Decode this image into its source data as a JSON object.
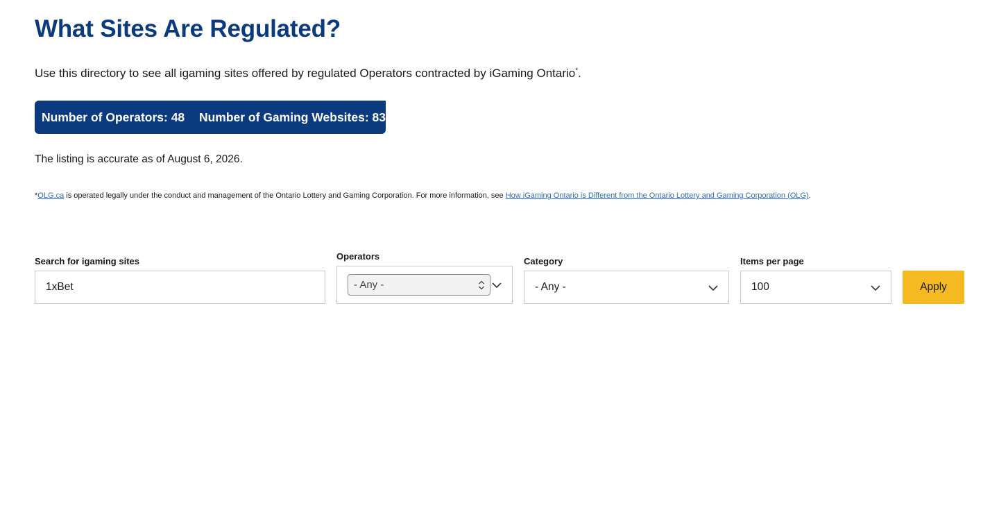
{
  "heading": "What Sites Are Regulated?",
  "intro": {
    "text": "Use this directory to see all igaming sites offered by regulated Operators contracted by iGaming Ontario",
    "marker": "*",
    "end": "."
  },
  "stats": {
    "operators_label": "Number of Operators: 48",
    "websites_label": "Number of Gaming Websites: 83"
  },
  "accuracy_note": "The listing is accurate as of August 6, 2026.",
  "footnote": {
    "marker": "*",
    "olg_link": "OLG.ca",
    "text": " is operated legally under the conduct and management of the Ontario Lottery and Gaming Corporation. For more information, see ",
    "info_link": "How iGaming Ontario is Different from the Ontario Lottery and Gaming Corporation (OLG)",
    "end": "."
  },
  "filters": {
    "search": {
      "label": "Search for igaming sites",
      "value": "1xBet"
    },
    "operators": {
      "label": "Operators",
      "value": "- Any -"
    },
    "category": {
      "label": "Category",
      "value": "- Any -"
    },
    "items_per_page": {
      "label": "Items per page",
      "value": "100"
    },
    "apply_label": "Apply"
  },
  "icons": [
    "chevron-down-icon",
    "up-down-arrows-icon"
  ],
  "colors": {
    "brand_blue": "#0b3a7e",
    "apply_yellow": "#f5b922",
    "link_blue": "#2a6ebb"
  }
}
